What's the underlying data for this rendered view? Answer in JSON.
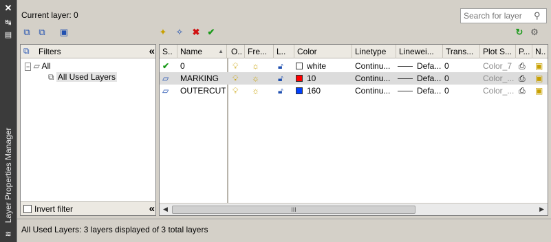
{
  "window": {
    "side_title": "Layer Properties Manager"
  },
  "header": {
    "current_layer": "Current layer: 0",
    "search_placeholder": "Search for layer"
  },
  "filters": {
    "title": "Filters",
    "tree": [
      {
        "label": "All"
      },
      {
        "label": "All Used Layers"
      }
    ],
    "invert_label": "Invert filter"
  },
  "columns": [
    "S..",
    "Name",
    "O..",
    "Fre...",
    "L..",
    "Color",
    "Linetype",
    "Linewei...",
    "Trans...",
    "Plot S...",
    "P...",
    "N.."
  ],
  "layers": [
    {
      "name": "0",
      "color_name": "white",
      "color_hex": "#ffffff",
      "linetype": "Continu...",
      "lineweight": "Defa...",
      "transparency": "0",
      "plot_style": "Color_7",
      "current": true
    },
    {
      "name": "MARKING",
      "color_name": "10",
      "color_hex": "#ff0000",
      "linetype": "Continu...",
      "lineweight": "Defa...",
      "transparency": "0",
      "plot_style": "Color_...",
      "current": false
    },
    {
      "name": "OUTERCUT",
      "color_name": "160",
      "color_hex": "#0040ff",
      "linetype": "Continu...",
      "lineweight": "Defa...",
      "transparency": "0",
      "plot_style": "Color_...",
      "current": false
    }
  ],
  "scrollbar": {
    "thumb_grip": "III"
  },
  "status_text": "All Used Layers: 3 layers displayed of 3 total layers"
}
